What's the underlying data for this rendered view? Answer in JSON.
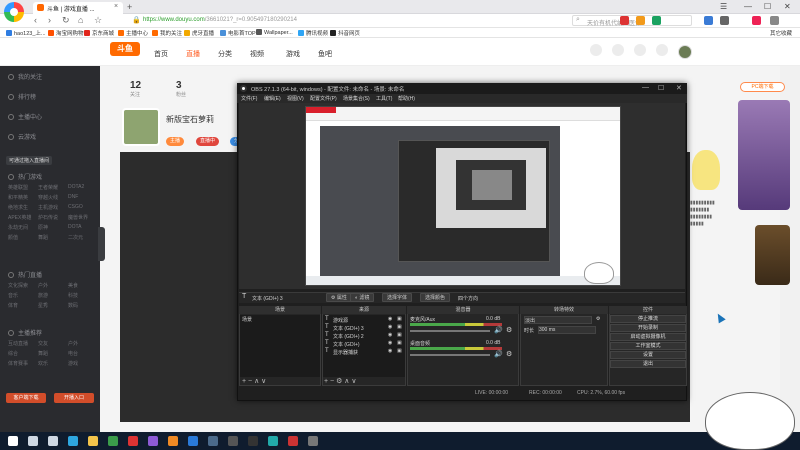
{
  "browser": {
    "tab_title": "斗鱼 | 游戏直播 ...",
    "url_host": "https://www.douyu.com",
    "url_path": "/3661021",
    "url_query": "?_r=0.905497180290214",
    "search_placeholder": "天价有机代纳入医保",
    "window_controls": [
      "☰",
      "—",
      "☐",
      "✕"
    ]
  },
  "bookmarks": [
    {
      "label": "hao123_上...",
      "color": "#2f7de1"
    },
    {
      "label": "淘宝网购物",
      "color": "#ff5000"
    },
    {
      "label": "京东商城",
      "color": "#e1251b"
    },
    {
      "label": "主播中心",
      "color": "#ff6a00"
    },
    {
      "label": "我的关注",
      "color": "#ff6a00"
    },
    {
      "label": "虎牙直播",
      "color": "#f2a900"
    },
    {
      "label": "电影首TOP",
      "color": "#4a90d9"
    },
    {
      "label": "Wallpaper...",
      "color": "#555555"
    },
    {
      "label": "腾讯视频",
      "color": "#2fa5f5"
    },
    {
      "label": "抖音网页",
      "color": "#222222"
    }
  ],
  "bookmarks_right": "其它收藏",
  "douyu": {
    "logo": "斗鱼",
    "nav": [
      "首页",
      "直播",
      "分类",
      "视频",
      "游戏",
      "鱼吧"
    ],
    "nav_active_index": 1,
    "stats": [
      {
        "num": "12",
        "label": "关注"
      },
      {
        "num": "3",
        "label": "粉丝"
      }
    ],
    "streamer_name": "新版宝石萝莉",
    "tags": [
      "主播",
      "直播中",
      "分区"
    ],
    "pc_button": "PC端下载"
  },
  "sidebar": {
    "top_items": [
      "我的关注",
      "排行榜",
      "主播中心",
      "云游戏"
    ],
    "tooltip": "可通过拖入直播间",
    "section1_title": "热门游戏",
    "section1_rows": [
      [
        "英雄联盟",
        "王者荣耀",
        "DOTA2"
      ],
      [
        "和平精英",
        "穿越火线",
        "DNF"
      ],
      [
        "绝地求生",
        "主机游戏",
        "CSGO"
      ],
      [
        "APEX英雄",
        "炉石传说",
        "魔兽世界"
      ],
      [
        "永劫无间",
        "原神",
        "DOTA"
      ],
      [
        "颜值",
        "舞蹈",
        "二次元"
      ]
    ],
    "section2_title": "热门直播",
    "section2_rows": [
      [
        "文化探索",
        "户外",
        "美食"
      ],
      [
        "音乐",
        "旅游",
        "科技"
      ],
      [
        "体育",
        "星秀",
        "数码"
      ]
    ],
    "section3_title": "主播推荐",
    "section3_rows": [
      [
        "互动直播",
        "交友",
        "户外"
      ],
      [
        "综合",
        "舞蹈",
        "电台"
      ],
      [
        "体育赛事",
        "欢乐",
        "游戏"
      ]
    ],
    "buttons": [
      "客户端下载",
      "开播入口"
    ]
  },
  "obs": {
    "title": "OBS 27.1.3 (64-bit, windows) - 配置文件: 未命名 - 场景: 未命名",
    "menu": [
      "文件(F)",
      "编辑(E)",
      "视图(V)",
      "配置文件(P)",
      "场景集合(S)",
      "工具(T)",
      "帮助(H)"
    ],
    "source_toolbar": {
      "current": "文本 (GDI+) 3",
      "buttons": [
        "属性",
        "滤镜",
        "选择字体",
        "选择颜色",
        "四个方向"
      ]
    },
    "docks": {
      "scenes": {
        "title": "场景",
        "items": [
          "场景"
        ]
      },
      "sources": {
        "title": "来源",
        "items": [
          "游戏源",
          "文本 (GDI+) 3",
          "文本 (GDI+) 2",
          "文本 (GDI+)",
          "显示器捕获"
        ]
      },
      "mixer": {
        "title": "混音器",
        "channels": [
          {
            "name": "麦克风/Aux",
            "db": "0.0 dB"
          },
          {
            "name": "桌面音频",
            "db": "0.0 dB"
          }
        ]
      },
      "transitions": {
        "title": "转场特效",
        "type": "淡出",
        "duration_label": "时长",
        "duration": "300 ms"
      },
      "controls": {
        "title": "控件",
        "buttons": [
          "停止推流",
          "开始录制",
          "启动虚拟摄像机",
          "工作室模式",
          "设置",
          "退出"
        ]
      }
    },
    "status": {
      "live": "LIVE: 00:00:00",
      "rec": "REC: 00:00:00",
      "cpu": "CPU: 2.7%, 60.00 fps"
    }
  },
  "taskbar_icons": [
    {
      "name": "start",
      "color": "#ffffff"
    },
    {
      "name": "search",
      "color": "#cfd8e3"
    },
    {
      "name": "task-view",
      "color": "#cfd8e3"
    },
    {
      "name": "edge",
      "color": "#2ea7e0"
    },
    {
      "name": "explorer",
      "color": "#f3c44b"
    },
    {
      "name": "browser",
      "color": "#3b9c4a"
    },
    {
      "name": "app-red",
      "color": "#d33"
    },
    {
      "name": "app-purple",
      "color": "#8e5bd6"
    },
    {
      "name": "app-orange",
      "color": "#f08a24"
    },
    {
      "name": "app-blue",
      "color": "#2a7ad8"
    },
    {
      "name": "steam",
      "color": "#4b6a8a"
    },
    {
      "name": "app-dark",
      "color": "#555"
    },
    {
      "name": "obs",
      "color": "#333"
    },
    {
      "name": "app-teal",
      "color": "#2aa"
    },
    {
      "name": "app-red2",
      "color": "#c33"
    },
    {
      "name": "app-gray",
      "color": "#777"
    }
  ],
  "colors": {
    "accent": "#ff5d23",
    "obs_bg": "#1f1f1f",
    "sidebar_bg": "#2a2b2f"
  }
}
